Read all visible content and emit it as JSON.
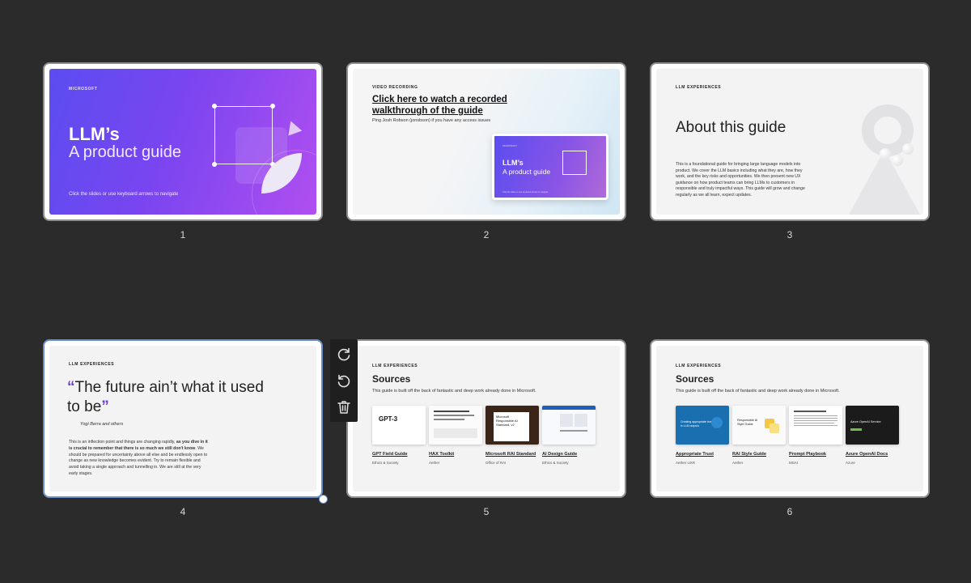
{
  "slides": [
    {
      "number": "1",
      "kicker": "MICROSOFT",
      "title_line1": "LLM’s",
      "title_line2": "A product guide",
      "hint": "Click the slides or use keyboard arrows to navigate"
    },
    {
      "number": "2",
      "kicker": "VIDEO RECORDING",
      "link": "Click here to watch a recorded walkthrough of the guide",
      "note": "Ping Josh Robson (jonsbson) if you have any access issues",
      "mini_kicker": "MICROSOFT",
      "mini_title1": "LLM’s",
      "mini_title2": "A product guide",
      "mini_hint": "Click the slides or use keyboard arrows to navigate"
    },
    {
      "number": "3",
      "kicker": "LLM EXPERIENCES",
      "title": "About this guide",
      "body": "This is a foundational guide for bringing large language models into product. We cover the LLM basics including what they are, how they work, and the key risks and opportunities. We then present new UX guidance on how product teams can bring LLMs to customers in responsible and truly impactful ways. This guide will grow and change regularly as we all learn, expect updates."
    },
    {
      "number": "4",
      "kicker": "LLM EXPERIENCES",
      "open_quote": "“",
      "quote": "The future ain’t what it used to be",
      "close_quote": "”",
      "attribution": "Yogi Berra and others",
      "body_pre": "This is an inflection point and things are changing rapidly, ",
      "body_bold": "as you dive in it is crucial to remember that there is so much we still don't know",
      "body_post": ". We should be prepared for uncertainty above all else and be endlessly open to change as new knowledge becomes evident. Try to remain flexible and avoid taking a single approach and tunnelling in. We are still at the very early stages."
    },
    {
      "number": "5",
      "kicker": "LLM EXPERIENCES",
      "title": "Sources",
      "subtitle": "This guide is built off the back of fantastic and deep work already done in Microsoft.",
      "cards": [
        {
          "name": "GPT Field Guide",
          "by": "Ethics & Society",
          "thumb_text": "GPT-3"
        },
        {
          "name": "HAX Toolkit",
          "by": "Aether",
          "thumb_text": ""
        },
        {
          "name": "Microsoft RAI Standard",
          "by": "Office of RAI",
          "thumb_text": "Microsoft Responsible AI Standard, v2"
        },
        {
          "name": "AI Design Guide",
          "by": "Ethics & Society",
          "thumb_text": ""
        }
      ]
    },
    {
      "number": "6",
      "kicker": "LLM EXPERIENCES",
      "title": "Sources",
      "subtitle": "This guide is built off the back of fantastic and deep work already done in Microsoft.",
      "cards": [
        {
          "name": "Appropriate Trust",
          "by": "Aether UXR",
          "thumb_text": "Creating appropriate trust in LLM outputs"
        },
        {
          "name": "RAI Style Guide",
          "by": "Aether",
          "thumb_text": "Responsible AI Style Guide"
        },
        {
          "name": "Prompt Playbook",
          "by": "MSAI",
          "thumb_text": ""
        },
        {
          "name": "Azure OpenAI Docs",
          "by": "Azure",
          "thumb_text": "Azure OpenAI Service"
        }
      ]
    }
  ],
  "toolbar": {
    "icons": [
      "redo-icon",
      "undo-icon",
      "trash-icon"
    ]
  },
  "colors": {
    "background": "#2b2b2b",
    "selection": "#6a8fc8",
    "accent_purple": "#6a3fd0"
  }
}
